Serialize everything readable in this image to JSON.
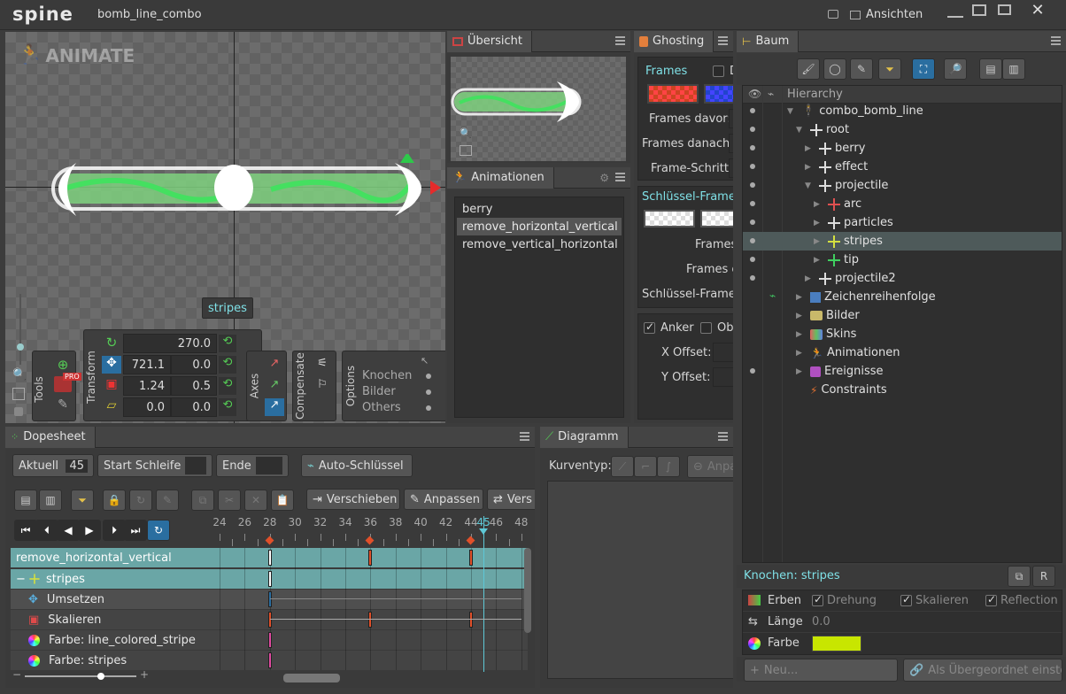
{
  "titlebar": {
    "logo": "spine",
    "project": "bomb_line_combo",
    "views_label": "Ansichten"
  },
  "viewport": {
    "watermark": "ANIMATE",
    "selection_label": "stripes",
    "tools_label": "Tools",
    "transform_label": "Transform",
    "axes_label": "Axes",
    "compensate_label": "Compensate",
    "options_label": "Options",
    "pro_badge": "PRO",
    "rotate_value": "270.0",
    "translate_x": "721.1",
    "translate_y": "0.0",
    "scale_x": "1.24",
    "scale_y": "0.5",
    "shear_x": "0.0",
    "shear_y": "0.0",
    "options": [
      "Knochen",
      "Bilder",
      "Others"
    ]
  },
  "overview": {
    "title": "Übersicht"
  },
  "animations": {
    "title": "Animationen",
    "items": [
      "berry",
      "remove_horizontal_vertical",
      "remove_vertical_horizontal"
    ],
    "selected": 1
  },
  "ghosting": {
    "title": "Ghosting",
    "frames_label": "Frames",
    "d_label": "D",
    "before_label": "Frames davor:",
    "after_label": "Frames danach:",
    "step_label": "Frame-Schritt:",
    "keyframes_label": "Schlüssel-Frames",
    "frames2_label": "Frames",
    "frames3_label": "Frames c",
    "keyframe_label": "Schlüssel-Frame-",
    "anchor_label": "Anker",
    "ob_label": "Obe",
    "xoffset_label": "X Offset:",
    "yoffset_label": "Y Offset:"
  },
  "tree": {
    "title": "Baum",
    "hierarchy_label": "Hierarchy",
    "rows": [
      {
        "label": "combo_bomb_line",
        "indent": 0,
        "icon": "skeleton-icon"
      },
      {
        "label": "root",
        "indent": 1,
        "icon": "bone-icon"
      },
      {
        "label": "berry",
        "indent": 2,
        "icon": "bone-icon"
      },
      {
        "label": "effect",
        "indent": 2,
        "icon": "bone-icon"
      },
      {
        "label": "projectile",
        "indent": 2,
        "icon": "bone-icon"
      },
      {
        "label": "arc",
        "indent": 3,
        "icon": "bone-red-icon"
      },
      {
        "label": "particles",
        "indent": 3,
        "icon": "bone-icon"
      },
      {
        "label": "stripes",
        "indent": 3,
        "icon": "bone-yellow-icon"
      },
      {
        "label": "tip",
        "indent": 3,
        "icon": "bone-green-icon"
      },
      {
        "label": "projectile2",
        "indent": 2,
        "icon": "bone-icon"
      },
      {
        "label": "Zeichenreihenfolge",
        "indent": 0,
        "icon": "draw-order-icon"
      },
      {
        "label": "Bilder",
        "indent": 0,
        "icon": "folder-icon"
      },
      {
        "label": "Skins",
        "indent": 0,
        "icon": "skins-icon"
      },
      {
        "label": "Animationen",
        "indent": 0,
        "icon": "animation-icon"
      },
      {
        "label": "Ereignisse",
        "indent": 0,
        "icon": "events-icon"
      },
      {
        "label": "Constraints",
        "indent": 0,
        "icon": "constraints-icon"
      }
    ],
    "selected": 7
  },
  "bone_props": {
    "title": "Knochen: stripes",
    "inherit_label": "Erben",
    "rotation_label": "Drehung",
    "scale_label": "Skalieren",
    "reflection_label": "Reflection",
    "length_label": "Länge",
    "length_value": "0.0",
    "color_label": "Farbe",
    "color_value": "#c8e600",
    "new_label": "Neu...",
    "set_parent_label": "Als Übergeordnet einstell"
  },
  "dopesheet": {
    "title": "Dopesheet",
    "current_label": "Aktuell",
    "current_value": "45",
    "loop_start_label": "Start Schleife",
    "end_label": "Ende",
    "autokey_label": "Auto-Schlüssel",
    "move_label": "Verschieben",
    "adjust_label": "Anpassen",
    "vers_label": "Vers",
    "ruler": [
      "24",
      "26",
      "28",
      "30",
      "32",
      "34",
      "36",
      "38",
      "40",
      "42",
      "44",
      "45",
      "46",
      "48"
    ],
    "playhead": "45",
    "rows": [
      {
        "label": "remove_horizontal_vertical",
        "kind": "anim"
      },
      {
        "label": "stripes",
        "kind": "bone"
      },
      {
        "label": "Umsetzen",
        "kind": "translate"
      },
      {
        "label": "Skalieren",
        "kind": "scale"
      },
      {
        "label": "Farbe: line_colored_stripe",
        "kind": "color"
      },
      {
        "label": "Farbe: stripes",
        "kind": "color"
      }
    ]
  },
  "graph": {
    "title": "Diagramm",
    "curve_label": "Kurventyp:",
    "adjust_label": "Anpa"
  },
  "colors": {
    "accent": "#5ec8d6",
    "selection": "#6aa6a6",
    "key_red": "#e0502a",
    "key_pink": "#e04aa0"
  }
}
